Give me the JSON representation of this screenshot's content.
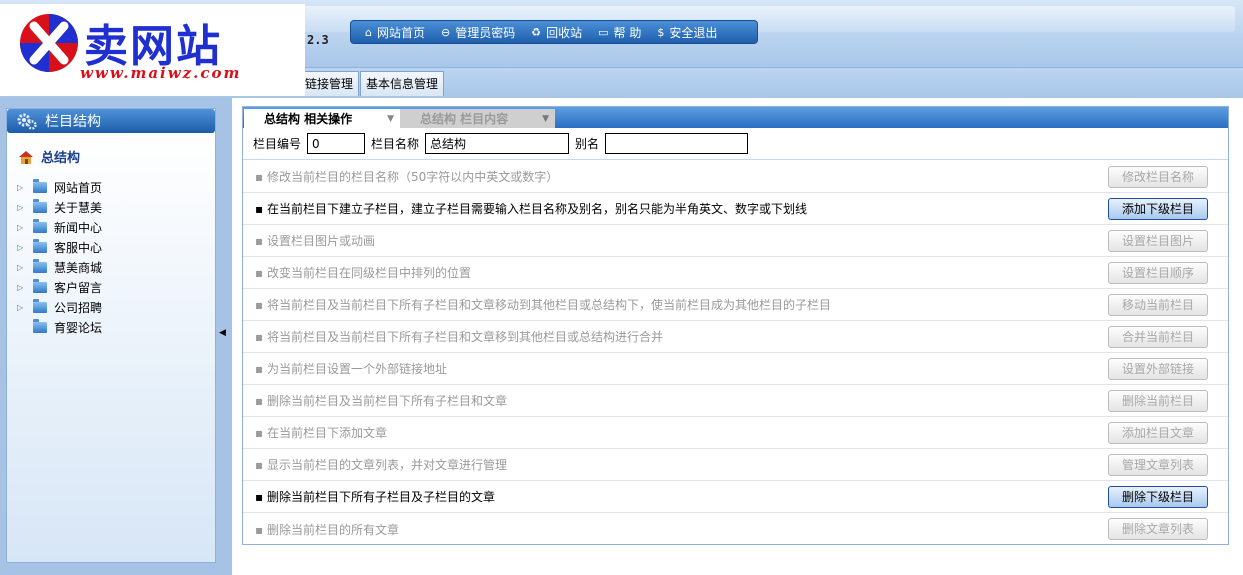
{
  "logo": {
    "brand": "卖网站",
    "url": "www.maiwz.com"
  },
  "version": "2.3",
  "topnav": [
    {
      "icon": "home-icon",
      "glyph": "⌂",
      "label": "网站首页"
    },
    {
      "icon": "key-icon",
      "glyph": "⊖",
      "label": "管理员密码"
    },
    {
      "icon": "recycle-icon",
      "glyph": "♻",
      "label": "回收站"
    },
    {
      "icon": "help-icon",
      "glyph": "▭",
      "label": "帮 助"
    },
    {
      "icon": "exit-icon",
      "glyph": "$",
      "label": "安全退出"
    }
  ],
  "toptabs": [
    "链接管理",
    "基本信息管理"
  ],
  "sidebar": {
    "title": "栏目结构",
    "root": "总结构",
    "items": [
      {
        "label": "网站首页",
        "expandable": true
      },
      {
        "label": "关于慧美",
        "expandable": true
      },
      {
        "label": "新闻中心",
        "expandable": true
      },
      {
        "label": "客服中心",
        "expandable": true
      },
      {
        "label": "慧美商城",
        "expandable": true
      },
      {
        "label": "客户留言",
        "expandable": true
      },
      {
        "label": "公司招聘",
        "expandable": true
      },
      {
        "label": "育婴论坛",
        "expandable": false
      }
    ]
  },
  "content": {
    "tabs": [
      {
        "label": "总结构 相关操作",
        "selected": true
      },
      {
        "label": "总结构 栏目内容",
        "selected": false
      }
    ],
    "form": {
      "id_label": "栏目编号",
      "id_value": "0",
      "name_label": "栏目名称",
      "name_value": "总结构",
      "alias_label": "别名",
      "alias_value": ""
    },
    "operations": [
      {
        "text": "▪ 修改当前栏目的栏目名称（50字符以内中英文或数字）",
        "button": "修改栏目名称",
        "enabled": false
      },
      {
        "text": "▪ 在当前栏目下建立子栏目，建立子栏目需要输入栏目名称及别名，别名只能为半角英文、数字或下划线",
        "button": "添加下级栏目",
        "enabled": true
      },
      {
        "text": "▪ 设置栏目图片或动画",
        "button": "设置栏目图片",
        "enabled": false
      },
      {
        "text": "▪ 改变当前栏目在同级栏目中排列的位置",
        "button": "设置栏目顺序",
        "enabled": false
      },
      {
        "text": "▪ 将当前栏目及当前栏目下所有子栏目和文章移动到其他栏目或总结构下，使当前栏目成为其他栏目的子栏目",
        "button": "移动当前栏目",
        "enabled": false
      },
      {
        "text": "▪ 将当前栏目及当前栏目下所有子栏目和文章移到其他栏目或总结构进行合并",
        "button": "合并当前栏目",
        "enabled": false
      },
      {
        "text": "▪ 为当前栏目设置一个外部链接地址",
        "button": "设置外部链接",
        "enabled": false
      },
      {
        "text": "▪ 删除当前栏目及当前栏目下所有子栏目和文章",
        "button": "删除当前栏目",
        "enabled": false
      },
      {
        "text": "▪ 在当前栏目下添加文章",
        "button": "添加栏目文章",
        "enabled": false
      },
      {
        "text": "▪ 显示当前栏目的文章列表，并对文章进行管理",
        "button": "管理文章列表",
        "enabled": false
      },
      {
        "text": "▪ 删除当前栏目下所有子栏目及子栏目的文章",
        "button": "删除下级栏目",
        "enabled": true
      },
      {
        "text": "▪ 删除当前栏目的所有文章",
        "button": "删除文章列表",
        "enabled": false
      }
    ]
  },
  "colors": {
    "accent": "#1c5caa",
    "panel": "#a6c3e5",
    "logo_blue": "#1f2fd0",
    "logo_red": "#d8101a"
  }
}
